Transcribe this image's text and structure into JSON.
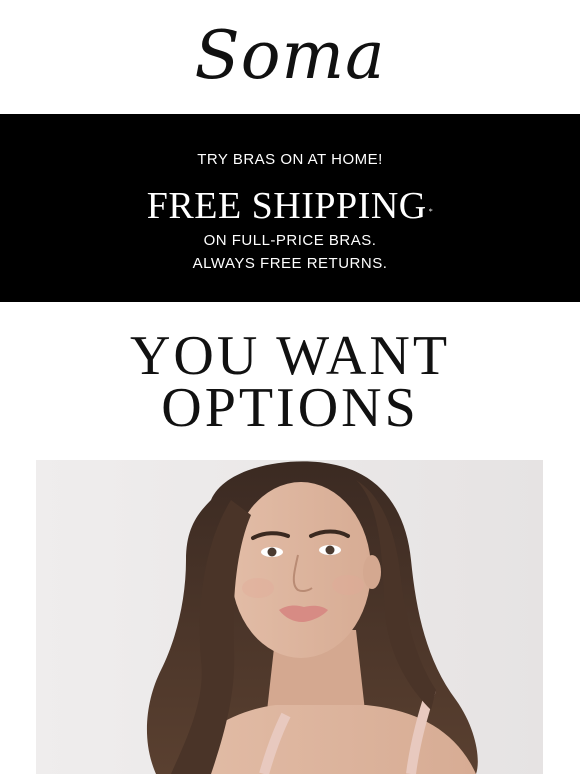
{
  "brand": {
    "logo_text": "Soma"
  },
  "promo_banner": {
    "eyebrow": "TRY BRAS ON AT HOME!",
    "headline": "FREE SHIPPING",
    "headline_mark": "*",
    "line1": "ON FULL-PRICE BRAS.",
    "line2": "ALWAYS FREE RETURNS."
  },
  "section": {
    "title_line1": "YOU WANT",
    "title_line2": "OPTIONS"
  },
  "colors": {
    "banner_bg": "#000000",
    "banner_text": "#ffffff",
    "page_bg": "#ffffff",
    "text": "#111111"
  }
}
